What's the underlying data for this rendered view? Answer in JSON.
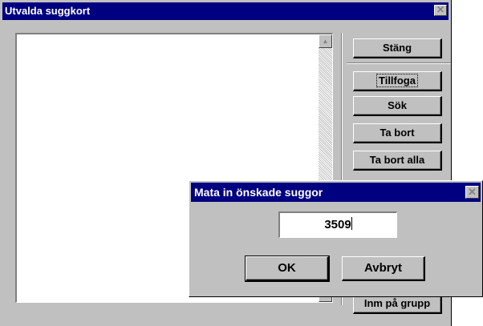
{
  "window": {
    "title": "Utvalda suggkort",
    "close_glyph": "✕"
  },
  "listbox": {
    "items": [],
    "scroll_up_glyph": "▲",
    "scroll_down_glyph": "▼"
  },
  "buttons": {
    "close": "Stäng",
    "add": "Tillfoga",
    "search": "Sök",
    "remove": "Ta bort",
    "remove_all": "Ta bort alla",
    "import_group": "Inm på grupp"
  },
  "dialog": {
    "title": "Mata in önskade suggor",
    "close_glyph": "✕",
    "input_value": "3509",
    "ok": "OK",
    "cancel": "Avbryt"
  },
  "colors": {
    "titlebar": "#000080",
    "face": "#c0c0c0"
  }
}
